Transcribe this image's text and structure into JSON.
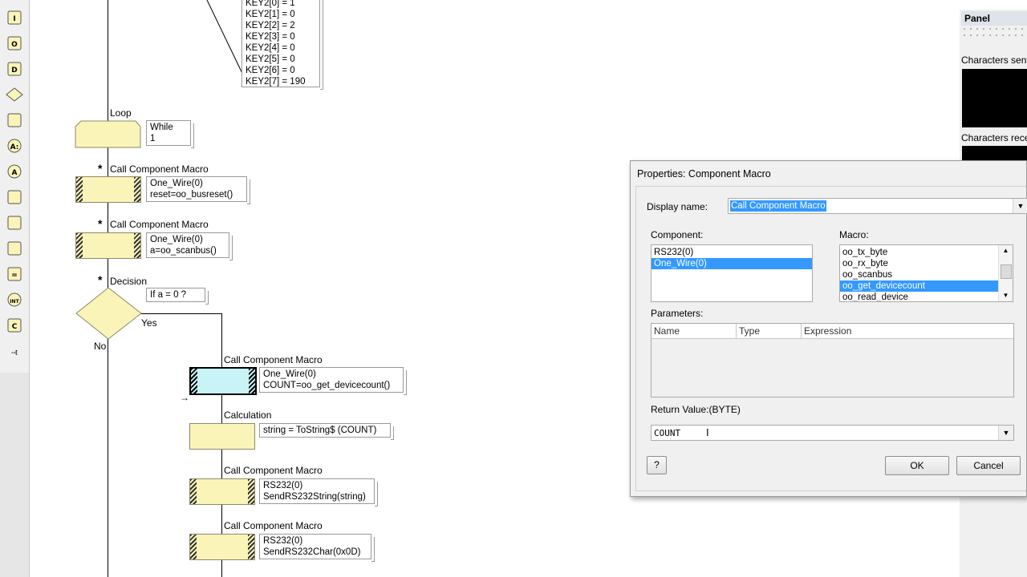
{
  "toolbar": {
    "tools": [
      {
        "icon": "input-icon",
        "glyph": "I"
      },
      {
        "icon": "output-icon",
        "glyph": "O"
      },
      {
        "icon": "delay-icon",
        "glyph": "D"
      },
      {
        "icon": "decision-icon",
        "glyph": ""
      },
      {
        "icon": "switch-icon",
        "glyph": ""
      },
      {
        "icon": "calculation-icon",
        "glyph": "A:"
      },
      {
        "icon": "connection-icon",
        "glyph": "A"
      },
      {
        "icon": "component-macro-icon",
        "glyph": ""
      },
      {
        "icon": "macro-icon",
        "glyph": ""
      },
      {
        "icon": "loop-icon",
        "glyph": ""
      },
      {
        "icon": "string-icon",
        "glyph": "="
      },
      {
        "icon": "interrupt-icon",
        "glyph": "INT"
      },
      {
        "icon": "c-code-icon",
        "glyph": "C"
      },
      {
        "icon": "comment-icon",
        "glyph": "--["
      }
    ]
  },
  "flowchart": {
    "key_block": [
      "KEY2[0] = 1",
      "KEY2[1] = 0",
      "KEY2[2] = 2",
      "KEY2[3] = 0",
      "KEY2[4] = 0",
      "KEY2[5] = 0",
      "KEY2[6] = 0",
      "KEY2[7] = 190"
    ],
    "loop": {
      "title": "Loop",
      "info": [
        "While",
        "1"
      ]
    },
    "macro1": {
      "title": "Call Component Macro",
      "info": [
        "One_Wire(0)",
        "reset=oo_busreset()"
      ]
    },
    "macro2": {
      "title": "Call Component Macro",
      "info": [
        "One_Wire(0)",
        "a=oo_scanbus()"
      ]
    },
    "decision": {
      "title": "Decision",
      "info": [
        "If  a = 0 ?"
      ],
      "yes": "Yes",
      "no": "No"
    },
    "macro3": {
      "title": "Call Component Macro",
      "info": [
        "One_Wire(0)",
        "COUNT=oo_get_devicecount()"
      ]
    },
    "calc": {
      "title": "Calculation",
      "info": [
        "string = ToString$ (COUNT)"
      ]
    },
    "macro4": {
      "title": "Call Component Macro",
      "info": [
        "RS232(0)",
        "SendRS232String(string)"
      ]
    },
    "macro5": {
      "title": "Call Component Macro",
      "info": [
        "RS232(0)",
        "SendRS232Char(0x0D)"
      ]
    },
    "star": "*",
    "arrow": "→"
  },
  "panel": {
    "title": "Panel",
    "sent_label": "Characters sent",
    "received_label": "Characters recei"
  },
  "dialog": {
    "title": "Properties: Component Macro",
    "display_name_label": "Display name:",
    "display_name_value": "Call Component Macro",
    "component_label": "Component:",
    "components": [
      {
        "label": "RS232(0)",
        "selected": false
      },
      {
        "label": "One_Wire(0)",
        "selected": true
      }
    ],
    "macro_label": "Macro:",
    "macros": [
      {
        "label": "oo_tx_byte",
        "selected": false
      },
      {
        "label": "oo_rx_byte",
        "selected": false
      },
      {
        "label": "oo_scanbus",
        "selected": false
      },
      {
        "label": "oo_get_devicecount",
        "selected": true
      },
      {
        "label": "oo_read_device",
        "selected": false
      }
    ],
    "parameters_label": "Parameters:",
    "param_columns": [
      "Name",
      "Type",
      "Expression"
    ],
    "return_label": "Return Value:(BYTE)",
    "return_value": "COUNT",
    "help_label": "?",
    "ok_label": "OK",
    "cancel_label": "Cancel"
  },
  "colors": {
    "block_fill": "#fbf4b8",
    "selected_block": "#c8f4f8",
    "selection": "#3399ff"
  }
}
